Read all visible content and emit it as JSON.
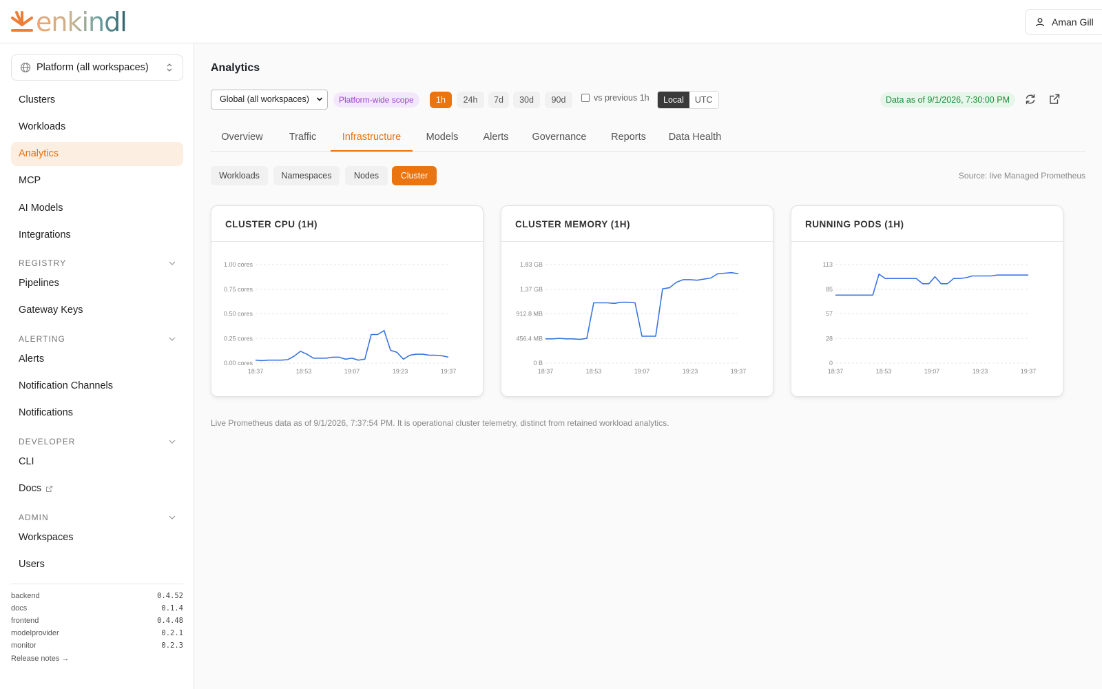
{
  "app": {
    "logo_text": "enkindl",
    "user_name": "Aman Gill"
  },
  "sidebar": {
    "workspace_select": "Platform (all workspaces)",
    "items_top": [
      {
        "label": "Clusters"
      },
      {
        "label": "Workloads"
      },
      {
        "label": "Analytics",
        "active": true
      },
      {
        "label": "MCP"
      },
      {
        "label": "AI Models"
      },
      {
        "label": "Integrations"
      }
    ],
    "sections": [
      {
        "title": "REGISTRY",
        "items": [
          {
            "label": "Pipelines"
          },
          {
            "label": "Gateway Keys"
          }
        ]
      },
      {
        "title": "ALERTING",
        "items": [
          {
            "label": "Alerts"
          },
          {
            "label": "Notification Channels"
          },
          {
            "label": "Notifications"
          }
        ]
      },
      {
        "title": "DEVELOPER",
        "items": [
          {
            "label": "CLI"
          },
          {
            "label": "Docs"
          }
        ]
      },
      {
        "title": "ADMIN",
        "items": [
          {
            "label": "Workspaces"
          },
          {
            "label": "Users"
          }
        ]
      }
    ],
    "versions": [
      {
        "name": "backend",
        "version": "0.4.52"
      },
      {
        "name": "docs",
        "version": "0.1.4"
      },
      {
        "name": "frontend",
        "version": "0.4.48"
      },
      {
        "name": "modelprovider",
        "version": "0.2.1"
      },
      {
        "name": "monitor",
        "version": "0.2.3"
      }
    ],
    "release_notes": "Release notes →"
  },
  "main": {
    "title": "Analytics",
    "toolbar": {
      "scope_select": "Global (all workspaces)",
      "scope_badge": "Platform-wide scope",
      "ranges": [
        {
          "label": "1h",
          "active": true
        },
        {
          "label": "24h"
        },
        {
          "label": "7d"
        },
        {
          "label": "30d"
        },
        {
          "label": "90d"
        }
      ],
      "compare_label": "vs previous 1h",
      "timezones": [
        {
          "label": "Local",
          "active": true
        },
        {
          "label": "UTC"
        }
      ],
      "data_as_of": "Data as of 9/1/2026, 7:30:00 PM"
    },
    "tabs": [
      {
        "label": "Overview"
      },
      {
        "label": "Traffic"
      },
      {
        "label": "Infrastructure",
        "active": true
      },
      {
        "label": "Models"
      },
      {
        "label": "Alerts"
      },
      {
        "label": "Governance"
      },
      {
        "label": "Reports"
      },
      {
        "label": "Data Health"
      }
    ],
    "subtabs": [
      {
        "label": "Workloads"
      },
      {
        "label": "Namespaces"
      },
      {
        "label": "Nodes"
      },
      {
        "label": "Cluster",
        "active": true
      }
    ],
    "source": "Source: live Managed Prometheus",
    "footnote": "Live Prometheus data as of 9/1/2026, 7:37:54 PM. It is operational cluster telemetry, distinct from retained workload analytics.",
    "colors": {
      "accent": "#ea7410",
      "line": "#3b74e0"
    }
  },
  "chart_data": [
    {
      "type": "line",
      "title": "CLUSTER CPU (1H)",
      "x_ticks": [
        "18:37",
        "18:53",
        "19:07",
        "19:23",
        "19:37"
      ],
      "y_ticks": [
        "1.00 cores",
        "0.75 cores",
        "0.50 cores",
        "0.25 cores",
        "0.00 cores"
      ],
      "ylim": [
        0,
        1.0
      ],
      "y": [
        0.03,
        0.025,
        0.03,
        0.03,
        0.03,
        0.035,
        0.07,
        0.12,
        0.09,
        0.05,
        0.05,
        0.05,
        0.06,
        0.06,
        0.04,
        0.05,
        0.03,
        0.04,
        0.29,
        0.29,
        0.33,
        0.13,
        0.11,
        0.04,
        0.08,
        0.09,
        0.09,
        0.08,
        0.08,
        0.075,
        0.06
      ]
    },
    {
      "type": "line",
      "title": "CLUSTER MEMORY (1H)",
      "x_ticks": [
        "18:37",
        "18:53",
        "19:07",
        "19:23",
        "19:37"
      ],
      "y_ticks": [
        "1.83 GB",
        "1.37 GB",
        "912.8 MB",
        "456.4 MB",
        "0 B"
      ],
      "ylim": [
        0,
        1.83
      ],
      "unit": "GB",
      "y": [
        0.45,
        0.45,
        0.46,
        0.45,
        0.45,
        0.44,
        0.46,
        1.12,
        1.12,
        1.12,
        1.11,
        1.13,
        1.13,
        1.12,
        0.5,
        0.5,
        0.5,
        1.38,
        1.4,
        1.5,
        1.55,
        1.55,
        1.54,
        1.56,
        1.58,
        1.66,
        1.67,
        1.68,
        1.66
      ]
    },
    {
      "type": "line",
      "title": "RUNNING PODS (1H)",
      "x_ticks": [
        "18:37",
        "18:53",
        "19:07",
        "19:23",
        "19:37"
      ],
      "y_ticks": [
        "113",
        "85",
        "57",
        "28",
        "0"
      ],
      "ylim": [
        0,
        113
      ],
      "y": [
        78,
        78,
        78,
        78,
        78,
        78,
        78,
        102,
        97,
        97,
        97,
        97,
        97,
        97,
        91,
        91,
        99,
        91,
        91,
        97,
        97,
        98,
        100,
        100,
        100,
        100,
        101,
        101,
        101,
        101,
        101,
        101
      ]
    }
  ]
}
